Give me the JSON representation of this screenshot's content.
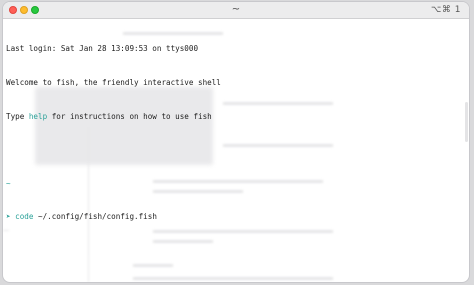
{
  "window": {
    "title": "~",
    "shortcut": "⌥⌘ 1"
  },
  "terminal": {
    "lines": [
      "Last login: Sat Jan 28 13:09:53 on ttys000",
      "Welcome to fish, the friendly interactive shell"
    ],
    "help_line": {
      "prefix": "Type ",
      "keyword": "help",
      "suffix": " for instructions on how to use fish"
    },
    "prompt_dir": "~",
    "prompt_symbol": "➤",
    "command": {
      "name": "code",
      "argument": " ~/.config/fish/config.fish"
    }
  },
  "colors": {
    "accent": "#2aa198",
    "text": "#1e1e1e",
    "close": "#ff5f57",
    "minimize": "#febc2e",
    "maximize": "#28c840"
  }
}
